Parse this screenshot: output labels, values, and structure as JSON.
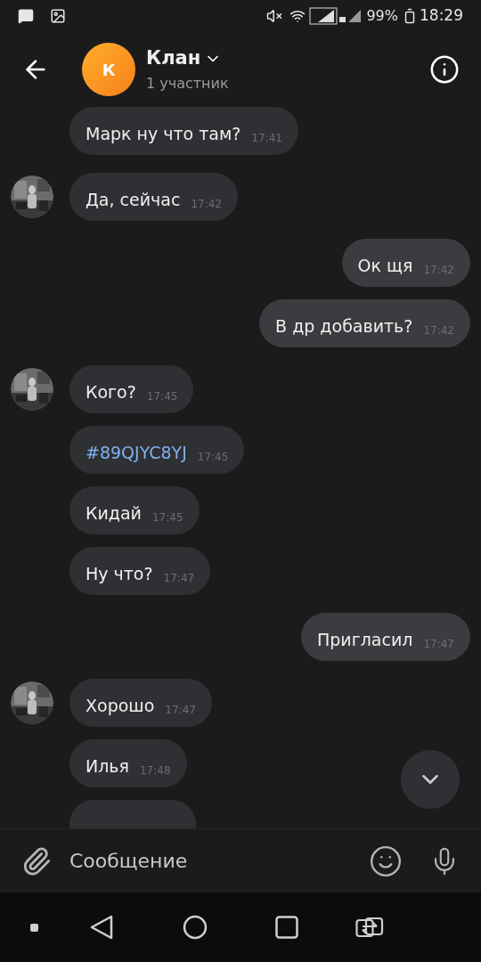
{
  "status_bar": {
    "battery": "99%",
    "time": "18:29"
  },
  "header": {
    "avatar_letter": "К",
    "title": "Клан",
    "subtitle": "1 участник"
  },
  "messages": [
    {
      "kind": "text",
      "outgoing": false,
      "avatar": false,
      "text": "Марк ну что там?",
      "time": "17:41"
    },
    {
      "kind": "text",
      "outgoing": false,
      "avatar": true,
      "text": "Да, сейчас",
      "time": "17:42"
    },
    {
      "kind": "text",
      "outgoing": true,
      "text": "Ок щя",
      "time": "17:42"
    },
    {
      "kind": "text",
      "outgoing": true,
      "text": "В др добавить?",
      "time": "17:42"
    },
    {
      "kind": "text",
      "outgoing": false,
      "avatar": true,
      "text": "Кого?",
      "time": "17:45"
    },
    {
      "kind": "link",
      "outgoing": false,
      "avatar": false,
      "text": "#89QJYC8YJ",
      "time": "17:45"
    },
    {
      "kind": "text",
      "outgoing": false,
      "avatar": false,
      "text": "Кидай",
      "time": "17:45"
    },
    {
      "kind": "text",
      "outgoing": false,
      "avatar": false,
      "text": "Ну что?",
      "time": "17:47"
    },
    {
      "kind": "text",
      "outgoing": true,
      "text": "Пригласил",
      "time": "17:47"
    },
    {
      "kind": "text",
      "outgoing": false,
      "avatar": true,
      "text": "Хорошо",
      "time": "17:47"
    },
    {
      "kind": "text",
      "outgoing": false,
      "avatar": false,
      "text": "Илья",
      "time": "17:48"
    },
    {
      "kind": "cut",
      "outgoing": false,
      "avatar": false
    }
  ],
  "composer": {
    "placeholder": "Сообщение"
  }
}
